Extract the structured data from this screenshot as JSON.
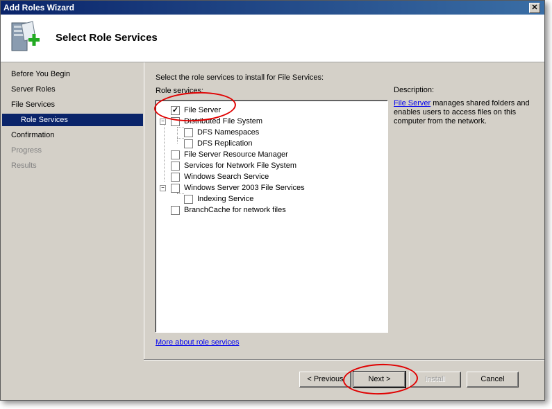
{
  "window": {
    "title": "Add Roles Wizard",
    "close_glyph": "✕"
  },
  "header": {
    "title": "Select Role Services",
    "icon": "server-roles-add-icon"
  },
  "nav": {
    "items": [
      {
        "label": "Before You Begin",
        "state": "normal"
      },
      {
        "label": "Server Roles",
        "state": "normal"
      },
      {
        "label": "File Services",
        "state": "normal"
      },
      {
        "label": "Role Services",
        "state": "active"
      },
      {
        "label": "Confirmation",
        "state": "normal"
      },
      {
        "label": "Progress",
        "state": "disabled"
      },
      {
        "label": "Results",
        "state": "disabled"
      }
    ]
  },
  "main": {
    "instruction": "Select the role services to install for File Services:",
    "role_services_label": "Role services:",
    "tree": [
      {
        "label": "File Server",
        "checked": true
      },
      {
        "label": "Distributed File System",
        "checked": false,
        "expander": "−"
      },
      {
        "label": "DFS Namespaces",
        "checked": false
      },
      {
        "label": "DFS Replication",
        "checked": false
      },
      {
        "label": "File Server Resource Manager",
        "checked": false
      },
      {
        "label": "Services for Network File System",
        "checked": false
      },
      {
        "label": "Windows Search Service",
        "checked": false
      },
      {
        "label": "Windows Server 2003 File Services",
        "checked": false,
        "expander": "−"
      },
      {
        "label": "Indexing Service",
        "checked": false
      },
      {
        "label": "BranchCache for network files",
        "checked": false
      }
    ],
    "check_glyph": "✓",
    "description_label": "Description:",
    "description_link": "File Server",
    "description_text": " manages shared folders and enables users to access files on this computer from the network.",
    "more_link": "More about role services"
  },
  "buttons": {
    "previous": "< Previous",
    "next": "Next >",
    "install": "Install",
    "cancel": "Cancel"
  },
  "colors": {
    "annotation": "#e00000",
    "selection": "#0a246a"
  }
}
